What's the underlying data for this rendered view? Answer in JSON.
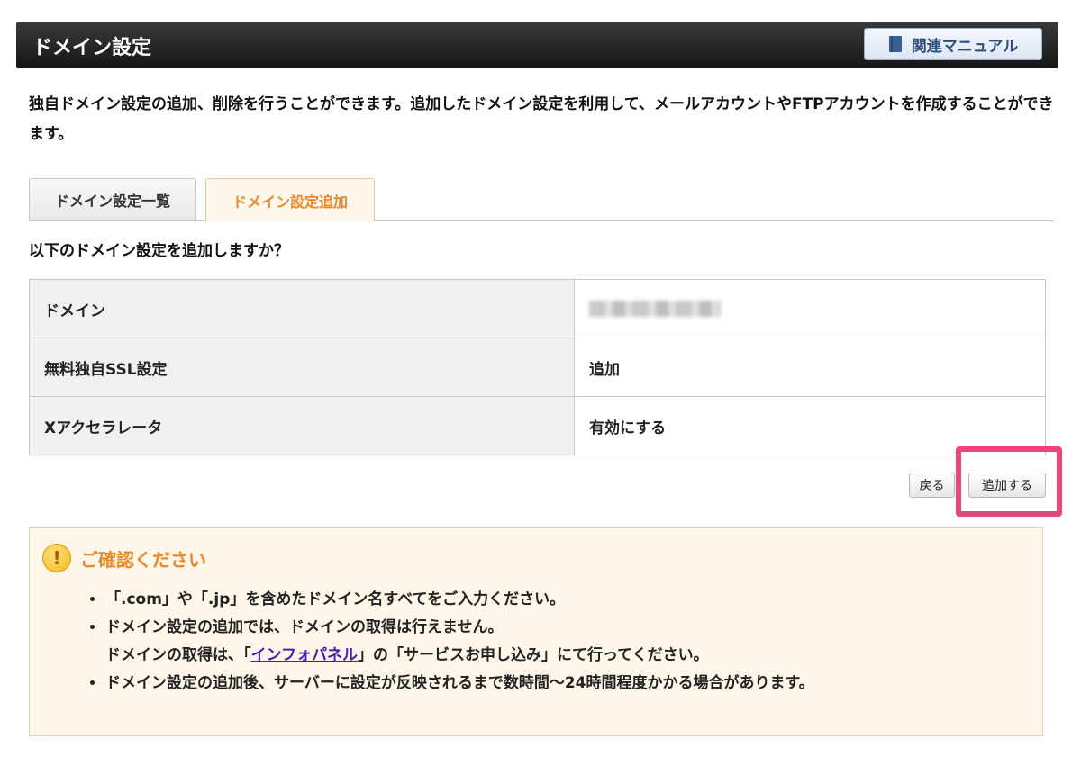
{
  "header": {
    "title": "ドメイン設定",
    "manual_button": "関連マニュアル"
  },
  "intro_text": "独自ドメイン設定の追加、削除を行うことができます。追加したドメイン設定を利用して、メールアカウントやFTPアカウントを作成することができます。",
  "tabs": [
    {
      "label": "ドメイン設定一覧",
      "active": false
    },
    {
      "label": "ドメイン設定追加",
      "active": true
    }
  ],
  "question": "以下のドメイン設定を追加しますか？",
  "table": {
    "rows": [
      {
        "label": "ドメイン",
        "value": ""
      },
      {
        "label": "無料独自SSL設定",
        "value": "追加"
      },
      {
        "label": "Xアクセラレータ",
        "value": "有効にする"
      }
    ]
  },
  "buttons": {
    "back": "戻る",
    "add": "追加する"
  },
  "notice": {
    "title": "ご確認ください",
    "items": [
      "「.com」や「.jp」を含めたドメイン名すべてをご入力ください。",
      "ドメイン設定の追加では、ドメインの取得は行えません。",
      "ドメイン設定の追加後、サーバーに設定が反映されるまで数時間〜24時間程度かかる場合があります。"
    ],
    "item2_line2_prefix": "ドメインの取得は、「",
    "item2_link": "インフォパネル",
    "item2_line2_suffix": "」の「サービスお申し込み」にて行ってください。"
  },
  "colors": {
    "accent_orange": "#e8892d",
    "highlight_pink": "#e8477a",
    "header_dark": "#1e1e1e",
    "link_purple": "#4a1fa6"
  }
}
